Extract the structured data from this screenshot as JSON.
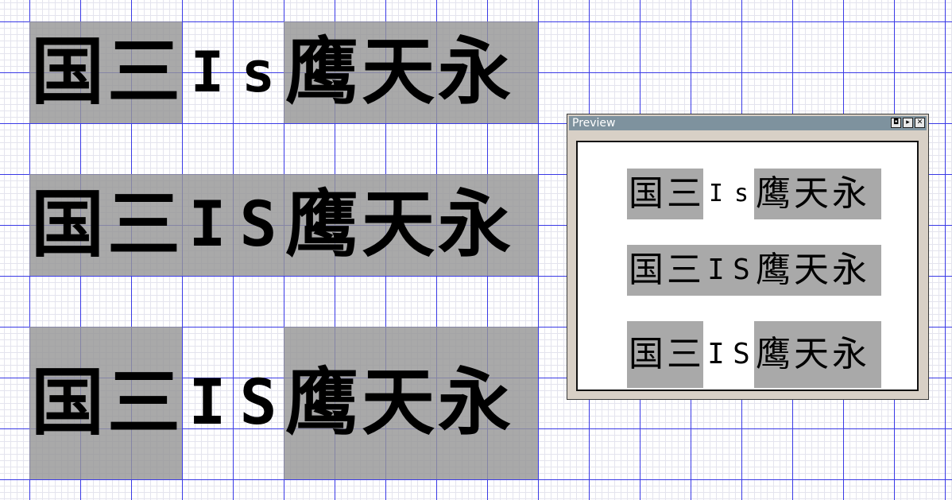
{
  "samples": [
    {
      "text": "国三Is鹰天永",
      "chars": [
        "国",
        "三",
        "I",
        "s",
        "鹰",
        "天",
        "永"
      ]
    },
    {
      "text": "国三IS鹰天永",
      "chars": [
        "国",
        "三",
        "I",
        "S",
        "鹰",
        "天",
        "永"
      ]
    },
    {
      "text": "国三IS鹰天永",
      "chars": [
        "国",
        "三",
        "I",
        "S",
        "鹰",
        "天",
        "永"
      ]
    }
  ],
  "preview": {
    "title": "Preview",
    "buttons": [
      "◘",
      "▸",
      "✕"
    ],
    "rows": [
      {
        "chars": [
          "国",
          "三",
          "I",
          "s",
          "鹰",
          "天",
          "永"
        ]
      },
      {
        "chars": [
          "国",
          "三",
          "I",
          "S",
          "鹰",
          "天",
          "永"
        ]
      },
      {
        "chars": [
          "国",
          "三",
          "I",
          "S",
          "鹰",
          "天",
          "永"
        ]
      }
    ]
  },
  "colors": {
    "grid_major": "#3a3ae6",
    "grid_minor": "#e4e4ee",
    "glyph_box": "#969696",
    "preview_titlebar": "#7e929e"
  }
}
